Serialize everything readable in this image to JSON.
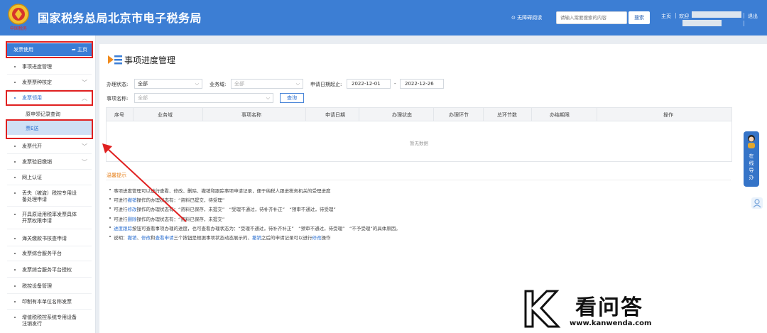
{
  "header": {
    "title": "国家税务总局北京市电子税务局",
    "accessibility": "⊙ 无障碍阅读",
    "search_placeholder": "请输入需要搜索的内容",
    "search_button": "搜索",
    "home": "主页",
    "welcome": "欢迎",
    "logout": "退出",
    "logo_caption": "中国税务"
  },
  "sidebar": {
    "head_title": "发票使用",
    "head_home": "主页",
    "items": [
      {
        "label": "事项进度管理"
      },
      {
        "label": "发票票种核定"
      },
      {
        "label": "发票领用"
      },
      {
        "label": "原申领记录查询"
      },
      {
        "label": "票E送"
      },
      {
        "label": "发票代开"
      },
      {
        "label": "发票验旧缴销"
      },
      {
        "label": "网上认证"
      },
      {
        "label": "丢失（被盗）税控专用设",
        "label2": "备处理申请"
      },
      {
        "label": "开具原适用税率发票具体",
        "label2": "开票权限申请"
      },
      {
        "label": "海关缴款书核查申请"
      },
      {
        "label": "发票综合服务平台"
      },
      {
        "label": "发票综合服务平台授权"
      },
      {
        "label": "税控设备管理"
      },
      {
        "label": "印制有本单位名称发票"
      },
      {
        "label": "增值税税控系统专用设备",
        "label2": "注销发行"
      }
    ]
  },
  "main": {
    "title": "事项进度管理",
    "filters": {
      "status_label": "办理状态:",
      "status_value": "全部",
      "domain_label": "业务域:",
      "domain_value": "全部",
      "date_label": "申请日期起止:",
      "date_from": "2022-12-01",
      "date_sep": "-",
      "date_to": "2022-12-26",
      "name_label": "事项名称:",
      "name_value": "全部",
      "query_button": "查询"
    },
    "table": {
      "columns": [
        "序号",
        "业务域",
        "事项名称",
        "申请日期",
        "办理状态",
        "办理环节",
        "总环节数",
        "办结期限",
        "操作"
      ],
      "empty_text": "暂无数据"
    },
    "tips_title": "温馨提示",
    "tips": [
      {
        "parts": [
          {
            "t": "事项进度管理可以进行查看、修改、删除、撤销和跟踪事项申请记录，便于纳税人跟进税务机关的受理进度"
          }
        ]
      },
      {
        "parts": [
          {
            "t": "可进行"
          },
          {
            "t": "撤销",
            "link": true
          },
          {
            "t": "操作的办理状态有：“资料已提交，待受理”"
          }
        ]
      },
      {
        "parts": [
          {
            "t": "可进行"
          },
          {
            "t": "修改",
            "link": true
          },
          {
            "t": "操作的办理状态有：“资料已保存，未提交”　“受理不通过，待补齐补正”　“预审不通过，待受理”"
          }
        ]
      },
      {
        "parts": [
          {
            "t": "可进行"
          },
          {
            "t": "删除",
            "link": true
          },
          {
            "t": "操作的办理状态有：“资料已保存，未提交”"
          }
        ]
      },
      {
        "parts": [
          {
            "t": "进度跟踪",
            "link": true
          },
          {
            "t": "按钮可查看事项办理的进度，也可查看办理状态为：“受理不通过，待补齐补正”　“预审不通过，待受理”　“不予受理”的具体原因。"
          }
        ]
      },
      {
        "parts": [
          {
            "t": "说明："
          },
          {
            "t": "撤销",
            "link": true
          },
          {
            "t": "、"
          },
          {
            "t": "修改",
            "link": true
          },
          {
            "t": "和"
          },
          {
            "t": "查看申请",
            "link": true
          },
          {
            "t": "三个按钮是根据事项状态动态展示的、"
          },
          {
            "t": "撤销",
            "link": true
          },
          {
            "t": "之后的申请记录可以进行"
          },
          {
            "t": "修改",
            "link": true
          },
          {
            "t": "操作"
          }
        ]
      }
    ]
  },
  "widget": {
    "online_label": "在线导办"
  },
  "watermark": {
    "cn": "看问答",
    "url": "www.kanwenda.com"
  },
  "colors": {
    "brand": "#3c7ed4",
    "highlight_box": "#e02020",
    "link": "#2b6fd0",
    "tip_title": "#e7811c"
  }
}
